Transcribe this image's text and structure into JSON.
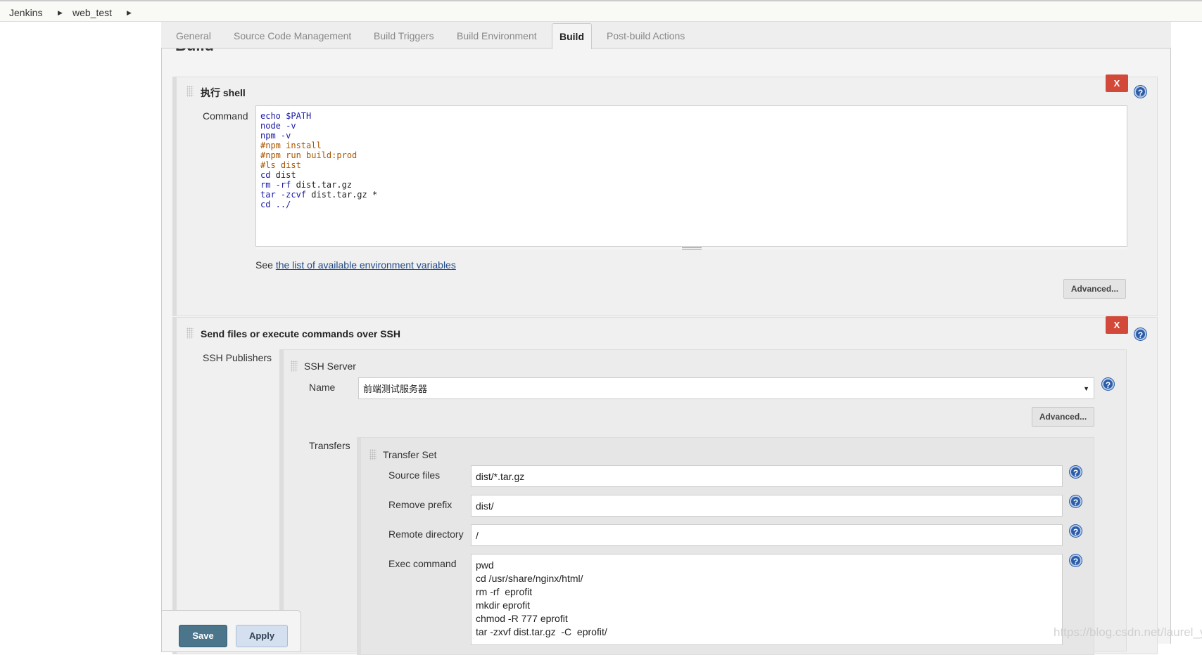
{
  "breadcrumb": {
    "items": [
      "Jenkins",
      "web_test"
    ]
  },
  "tabs": [
    "General",
    "Source Code Management",
    "Build Triggers",
    "Build Environment",
    "Build",
    "Post-build Actions"
  ],
  "active_tab": "Build",
  "section_heading": "Build",
  "shell_step": {
    "title": "执行 shell",
    "command_label": "Command",
    "command_lines": [
      {
        "t": "echo $PATH",
        "c": "kw"
      },
      {
        "t": "node -v",
        "c": "kw"
      },
      {
        "t": "npm -v",
        "c": "kw"
      },
      {
        "t": "#npm install",
        "c": "cm"
      },
      {
        "t": "#npm run build:prod",
        "c": "cm"
      },
      {
        "t": "#ls dist",
        "c": "cm"
      },
      {
        "t": "cd dist",
        "c": "tx"
      },
      {
        "t": "rm -rf dist.tar.gz",
        "c": "tx"
      },
      {
        "t": "tar -zcvf dist.tar.gz *",
        "c": "tx"
      },
      {
        "t": "cd ../",
        "c": "kw"
      }
    ],
    "see_prefix": "See ",
    "env_link": "the list of available environment variables",
    "advanced": "Advanced...",
    "delete": "X"
  },
  "ssh_step": {
    "title": "Send files or execute commands over SSH",
    "publishers_label": "SSH Publishers",
    "delete": "X",
    "server": {
      "title": "SSH Server",
      "name_label": "Name",
      "name_value": "前端测试服务器",
      "advanced": "Advanced...",
      "transfers_label": "Transfers",
      "transfer_set": {
        "title": "Transfer Set",
        "source_label": "Source files",
        "source_value": "dist/*.tar.gz",
        "prefix_label": "Remove prefix",
        "prefix_value": "dist/",
        "remote_label": "Remote directory",
        "remote_value": "/",
        "exec_label": "Exec command",
        "exec_value": "pwd\ncd /usr/share/nginx/html/\nrm -rf  eprofit\nmkdir eprofit\nchmod -R 777 eprofit\ntar -zxvf dist.tar.gz  -C  eprofit/"
      }
    }
  },
  "footer": {
    "save": "Save",
    "apply": "Apply"
  },
  "watermark": "https://blog.csdn.net/laurel_y",
  "colors": {
    "delete": "#d24939",
    "save": "#4b758b",
    "apply": "#d4e0f0",
    "help": "#2a5ca8"
  }
}
